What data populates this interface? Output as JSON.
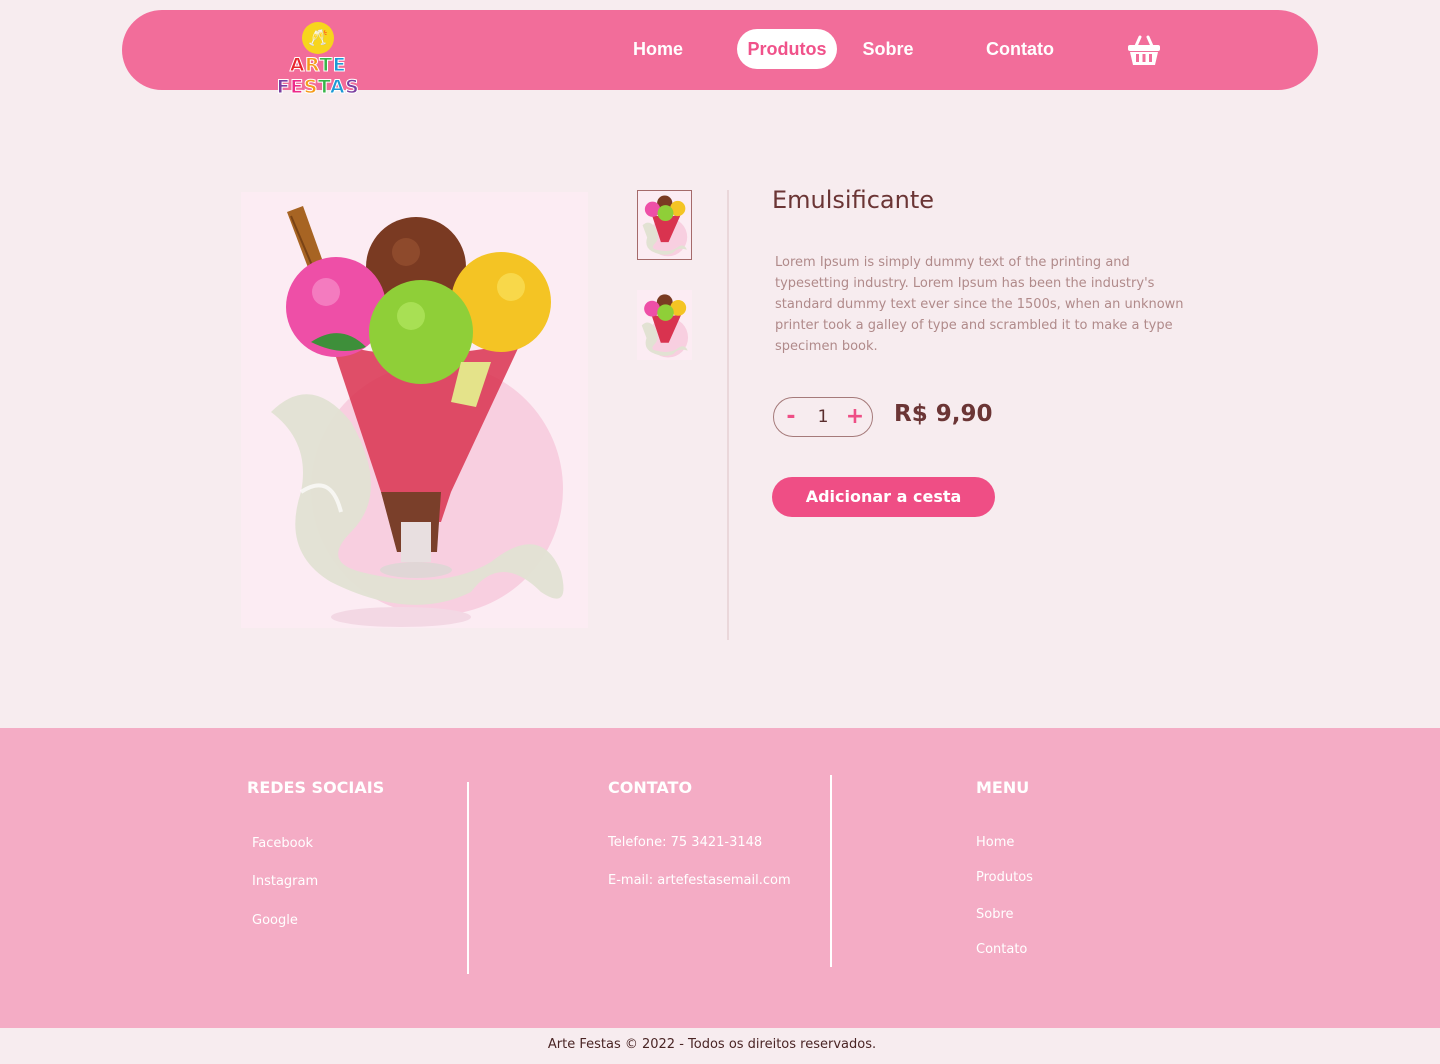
{
  "brand": {
    "logo_text": "ARTE FESTAS",
    "logo_colors": [
      "#e8242c",
      "#f59b1b",
      "#39b54a",
      "#1c9ad6",
      "#7c3fa0",
      "#ec2a8a",
      "#f7d51d"
    ]
  },
  "nav": {
    "items": [
      {
        "label": "Home"
      },
      {
        "label": "Produtos",
        "active": true
      },
      {
        "label": "Sobre"
      },
      {
        "label": "Contato"
      }
    ],
    "cart_icon": "basket-icon"
  },
  "product": {
    "title": "Emulsificante",
    "description": "Lorem Ipsum is simply dummy text of the printing and typesetting industry. Lorem Ipsum has been the industry's standard dummy text ever since the 1500s, when an unknown printer took a galley of type and scrambled it to make a type specimen book.",
    "quantity": "1",
    "minus_label": "-",
    "plus_label": "+",
    "price": "R$ 9,90",
    "add_button": "Adicionar a cesta",
    "thumbnail_count": 2,
    "selected_thumbnail": 1
  },
  "footer": {
    "social": {
      "heading": "REDES SOCIAIS",
      "links": [
        "Facebook",
        "Instagram",
        "Google"
      ]
    },
    "contact": {
      "heading": "CONTATO",
      "phone": "Telefone: 75 3421-3148",
      "email": "E-mail: artefestasemail.com"
    },
    "menu": {
      "heading": "MENU",
      "links": [
        "Home",
        "Produtos",
        "Sobre",
        "Contato"
      ]
    },
    "copyright": "Arte Festas © 2022 - Todos os direitos reservados."
  },
  "colors": {
    "primary_pink": "#f26d9a",
    "button_pink": "#ef4e85",
    "footer_pink": "#f4acc5",
    "background": "#f7ecef",
    "text_brown": "#6b3535"
  }
}
